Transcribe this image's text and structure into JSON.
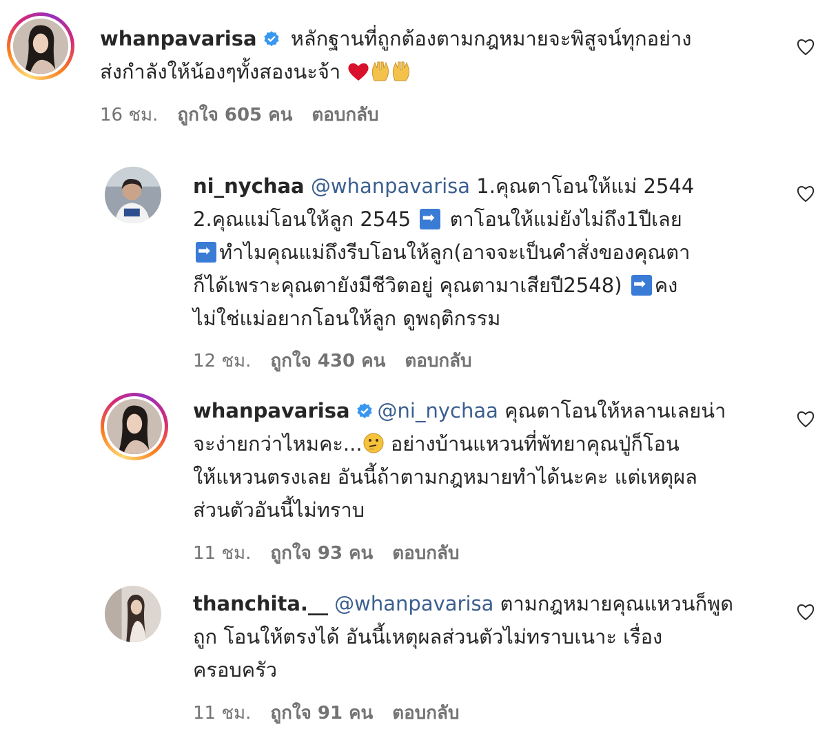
{
  "comments": [
    {
      "username": "whanpavarisa",
      "verified": true,
      "mention": "",
      "lines": [
        "หลักฐานที่ถูกต้องตามกฎหมายจะพิสูจน์ทุกอย่าง",
        "ส่งกำลังให้น้องๆทั้งสองนะจ้า"
      ],
      "time": "16 ชม.",
      "likes": "ถูกใจ 605 คน",
      "reply": "ตอบกลับ"
    },
    {
      "username": "ni_nychaa",
      "verified": false,
      "mention": "@whanpavarisa",
      "lines": [
        "1.คุณตาโอนให้แม่ 2544",
        "2.คุณแม่โอนให้ลูก 2545",
        "ตาโอนให้แม่ยังไม่ถึง1ปีเลย",
        "ทำไมคุณแม่ถึงรีบโอนให้ลูก(อาจจะเป็นคำสั่งของคุณตา",
        "ก็ได้เพราะคุณตายังมีชีวิตอยู่ คุณตามาเสียปี2548)",
        "คง",
        "ไม่ใช่แม่อยากโอนให้ลูก ดูพฤติกรรม"
      ],
      "time": "12 ชม.",
      "likes": "ถูกใจ 430 คน",
      "reply": "ตอบกลับ"
    },
    {
      "username": "whanpavarisa",
      "verified": true,
      "mention": "@ni_nychaa",
      "lines": [
        "คุณตาโอนให้หลานเลยน่า",
        "จะง่ายกว่าไหมคะ...",
        "อย่างบ้านแหวนที่พัทยาคุณปู่ก็โอน",
        "ให้แหวนตรงเลย อันนี้ถ้าตามกฎหมายทำได้นะคะ แต่เหตุผล",
        "ส่วนตัวอันนี้ไม่ทราบ"
      ],
      "time": "11 ชม.",
      "likes": "ถูกใจ 93 คน",
      "reply": "ตอบกลับ"
    },
    {
      "username": "thanchita.__",
      "verified": false,
      "mention": "@whanpavarisa",
      "lines": [
        "ตามกฎหมายคุณแหวนก็พูด",
        "ถูก โอนให้ตรงได้ อันนี้เหตุผลส่วนตัวไม่ทราบเนาะ เรื่อง",
        "ครอบครัว"
      ],
      "time": "11 ชม.",
      "likes": "ถูกใจ 91 คน",
      "reply": "ตอบกลับ"
    }
  ],
  "icons": {
    "heart": "heart-outline-icon",
    "verified": "verified-badge-icon",
    "arrow": "right-arrow-emoji",
    "colors": {
      "verified": "#3897f0",
      "mention": "#3b5f8f",
      "meta": "#737373",
      "arrow": "#3a7bd5"
    }
  }
}
